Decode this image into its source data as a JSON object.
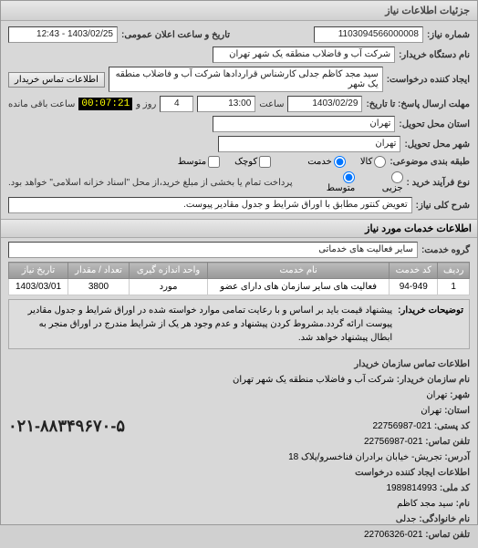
{
  "window": {
    "title": "جزئیات اطلاعات نیاز"
  },
  "header": {
    "number_label": "شماره نیاز:",
    "number_value": "1103094566000008",
    "public_date_label": "تاریخ و ساعت اعلان عمومی:",
    "public_date_value": "1403/02/25 - 12:43",
    "buyer_org_label": "نام دستگاه خریدار:",
    "buyer_org_value": "شرکت آب و فاضلاب منطقه یک شهر تهران",
    "requester_label": "ایجاد کننده درخواست:",
    "requester_value": "سید مجد کاظم جدلی کارشناس قراردادها شرکت آب و فاضلاب منطقه یک شهر",
    "contact_btn": "اطلاعات تماس خریدار",
    "deadline_label": "مهلت ارسال پاسخ: تا تاریخ:",
    "deadline_date": "1403/02/29",
    "time_label": "ساعت",
    "deadline_time": "13:00",
    "days_label": "روز و",
    "days_value": "4",
    "remain_time": "00:07:21",
    "remain_label": "ساعت باقی مانده",
    "province_label": "استان محل تحویل:",
    "province_value": "تهران",
    "city_label": "شهر محل تحویل:",
    "city_value": "تهران",
    "category_label": "طبقه بندی موضوعی:",
    "cat_goods": "کالا",
    "cat_service": "خدمت",
    "size_small": "کوچک",
    "size_medium": "متوسط",
    "process_label": "نوع فرآیند خرید :",
    "proc_partial": "جزیی",
    "proc_medium": "متوسط",
    "proc_note": "پرداخت تمام یا بخشی از مبلغ خرید،از محل \"اسناد خزانه اسلامی\" خواهد بود.",
    "desc_label": "شرح کلی نیاز:",
    "desc_value": "تعویض کنتور مطابق با اوراق شرایط و جدول مقادیر پیوست."
  },
  "services": {
    "section_title": "اطلاعات خدمات مورد نیاز",
    "group_label": "گروه خدمت:",
    "group_value": "سایر فعالیت های خدماتی",
    "columns": [
      "ردیف",
      "کد خدمت",
      "نام خدمت",
      "واحد اندازه گیری",
      "تعداد / مقدار",
      "تاریخ نیاز"
    ],
    "rows": [
      {
        "idx": "1",
        "code": "94-949",
        "name": "فعالیت های سایر سازمان های دارای عضو",
        "unit": "مورد",
        "qty": "3800",
        "date": "1403/03/01"
      }
    ],
    "note_label": "توضیحات خریدار:",
    "note_text": "پیشنهاد قیمت باید بر اساس و با رعایت تمامی موارد خواسته شده در اوراق شرایط و جدول مقادیر پیوست ارائه گردد.مشروط کردن پیشنهاد و عدم وجود هر یک از شرایط مندرج در اوراق منجر به ابطال پیشنهاد خواهد شد."
  },
  "contact": {
    "section_title": "اطلاعات تماس سازمان خریدار",
    "org_label": "نام سازمان خریدار:",
    "org_value": "شرکت آب و فاضلاب منطقه یک شهر تهران",
    "city_label": "شهر:",
    "city_value": "تهران",
    "province_label": "استان:",
    "province_value": "تهران",
    "postal_label": "کد پستی:",
    "postal_value": "021-22756987",
    "phone_label": "تلفن تماس:",
    "phone_value": "021-22756987",
    "big_phone": "۰۲۱-۸۸۳۴۹۶۷۰-۵",
    "address_label": "آدرس:",
    "address_value": "تجریش- خیابان برادران فناخسرو/پلاک 18",
    "creator_section": "اطلاعات ایجاد کننده درخواست",
    "natid_label": "کد ملی:",
    "natid_value": "1989814993",
    "name_label": "نام:",
    "name_value": "سید مجد کاظم",
    "lname_label": "نام خانوادگی:",
    "lname_value": "جدلی",
    "cphone_label": "تلفن تماس:",
    "cphone_value": "021-22706326"
  }
}
